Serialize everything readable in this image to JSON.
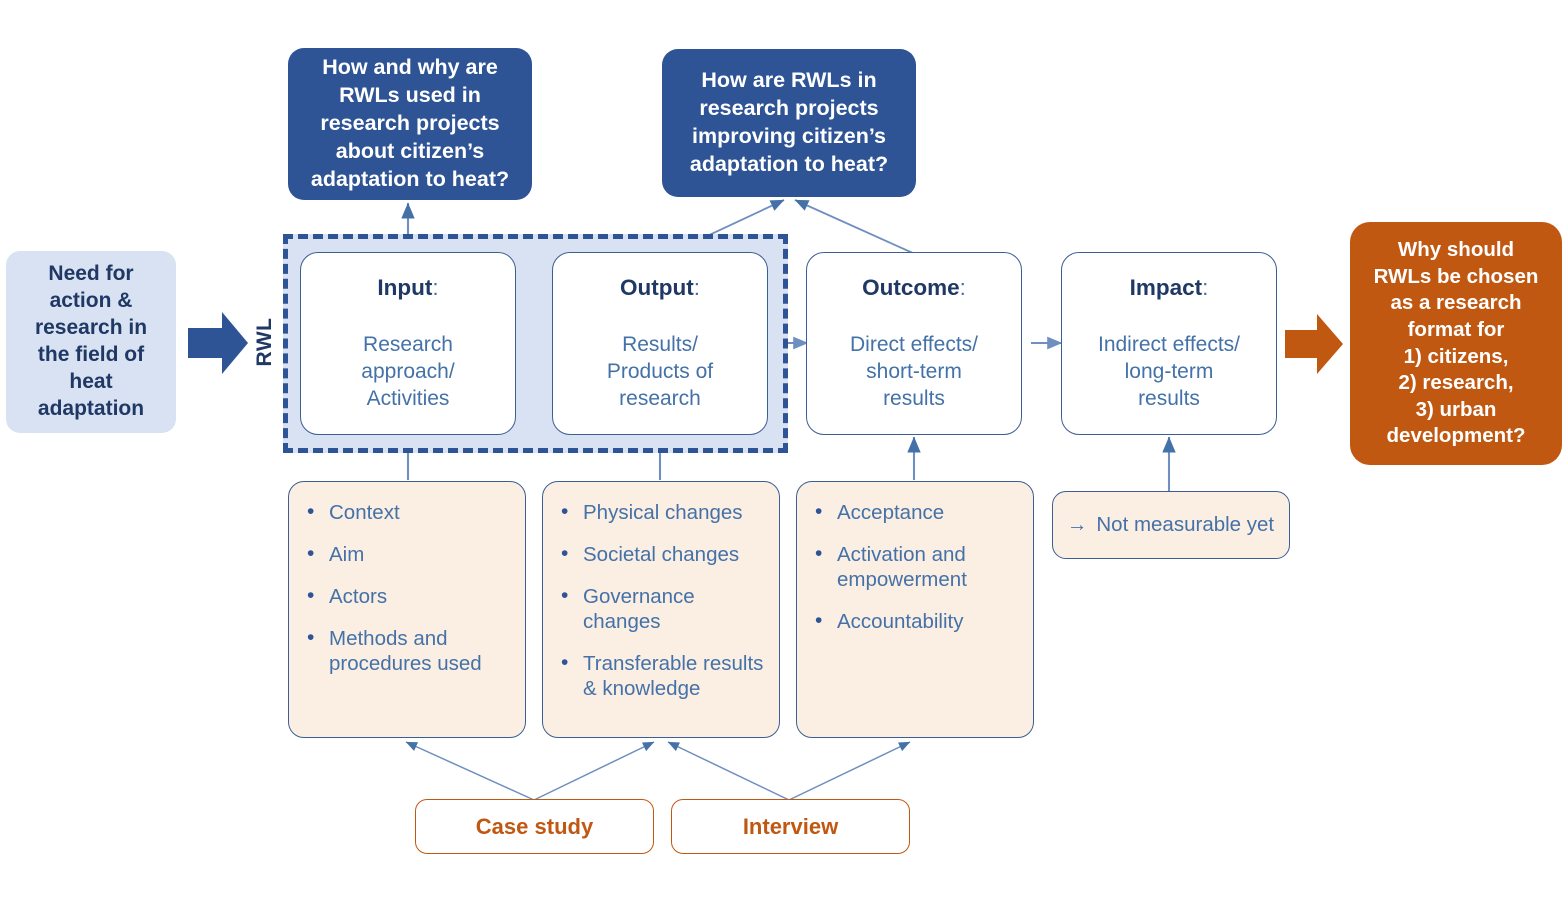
{
  "source": {
    "need_box": {
      "lines": [
        "Need for",
        "action &",
        "research in",
        "the field of",
        "heat",
        "adaptation"
      ],
      "color": "#d9e2f3"
    },
    "arrow_in": {
      "icon": "right-arrow-icon",
      "color": "#2e5496"
    }
  },
  "questions": [
    {
      "id": "q1",
      "lines": [
        "How and why are",
        "RWLs used in",
        "research projects",
        "about citizen’s",
        "adaptation to heat?"
      ],
      "color": "#2e5496"
    },
    {
      "id": "q2",
      "lines": [
        "How are RWLs in",
        "research projects",
        "improving citizen’s",
        "adaptation to heat?"
      ],
      "color": "#2e5496"
    }
  ],
  "rwl": {
    "label": "RWL",
    "container_color": "#d9e2f3",
    "border_color": "#2e5496"
  },
  "chain": [
    {
      "id": "input",
      "title": "Input",
      "colon": ":",
      "body_lines": [
        "Research",
        "approach/",
        "Activities"
      ]
    },
    {
      "id": "output",
      "title": "Output",
      "colon": ":",
      "body_lines": [
        "Results/",
        "Products of",
        "research"
      ]
    },
    {
      "id": "outcome",
      "title": "Outcome",
      "colon": ":",
      "body_lines": [
        "Direct effects/",
        "short-term",
        "results"
      ]
    },
    {
      "id": "impact",
      "title": "Impact",
      "colon": ":",
      "body_lines": [
        "Indirect effects/",
        "long-term",
        "results"
      ]
    }
  ],
  "details": [
    {
      "id": "input-details",
      "items": [
        "Context",
        "Aim",
        "Actors",
        "Methods and procedures used"
      ]
    },
    {
      "id": "output-details",
      "items": [
        "Physical changes",
        "Societal changes",
        "Governance changes",
        "Transferable results & knowledge"
      ]
    },
    {
      "id": "outcome-details",
      "items": [
        "Acceptance",
        "Activation and empowerment",
        "Accountability"
      ]
    }
  ],
  "impact_note": {
    "id": "impact-note",
    "arrow_glyph": "→",
    "text": "Not measurable yet"
  },
  "methods": [
    {
      "id": "case-study",
      "label": "Case study"
    },
    {
      "id": "interview",
      "label": "Interview"
    }
  ],
  "conclusion": {
    "arrow": {
      "icon": "right-arrow-icon",
      "color": "#c15811"
    },
    "lines": [
      "Why should",
      "RWLs be chosen",
      "as a research",
      "format for",
      "1) citizens,",
      "2) research,",
      "3) urban",
      "development?"
    ],
    "color": "#c15811"
  },
  "palette": {
    "navy_dark": "#1f3864",
    "navy": "#2e5496",
    "blue_mid": "#4472a8",
    "light_blue": "#d9e2f3",
    "peach": "#fbeee3",
    "orange": "#c15811",
    "connector": "#6f8fc0"
  }
}
